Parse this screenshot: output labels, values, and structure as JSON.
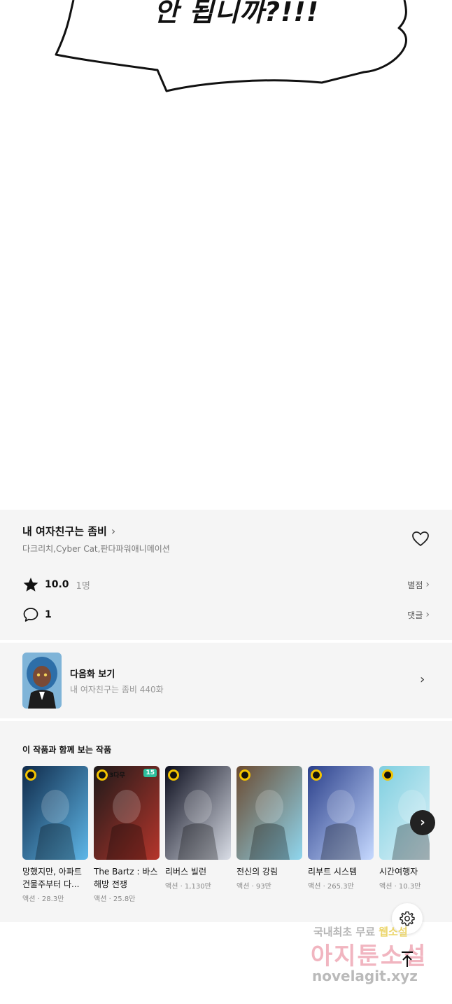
{
  "comic": {
    "bubble_text": "안 됩니까?!!!"
  },
  "work": {
    "title": "내 여자친구는 좀비",
    "title_chevron": "›",
    "authors": "다크리치,Cyber Cat,판다파워애니메이션",
    "rating_value": "10.0",
    "rating_count": "1명",
    "rating_link": "별점",
    "comment_count": "1",
    "comment_link": "댓글",
    "link_chevron": "›"
  },
  "next_episode": {
    "label": "다음화 보기",
    "subtitle": "내 여자친구는 좀비 440화",
    "chevron": "›"
  },
  "recommendations": {
    "heading": "이 작품과 함께 보는 작품",
    "items": [
      {
        "title": "망했지만, 아파트 건물주부터 다...",
        "meta": "액션 · 28.3만",
        "badge": "",
        "num": "",
        "color_a": "#0f2a4a",
        "color_b": "#5fb7e8"
      },
      {
        "title": "The Bartz : 바스해방 전쟁",
        "meta": "액션 · 25.8만",
        "badge": "3다무",
        "num": "15",
        "color_a": "#1d1a1a",
        "color_b": "#b5352b"
      },
      {
        "title": "리버스 빌런",
        "meta": "액션 · 1,130만",
        "badge": "",
        "num": "",
        "color_a": "#0b0d1d",
        "color_b": "#d9dde6"
      },
      {
        "title": "전신의 강림",
        "meta": "액션 · 93만",
        "badge": "",
        "num": "",
        "color_a": "#6b4a30",
        "color_b": "#8fd6ee"
      },
      {
        "title": "리부트 시스템",
        "meta": "액션 · 265.3만",
        "badge": "",
        "num": "",
        "color_a": "#2a3f8a",
        "color_b": "#c6d9ff"
      },
      {
        "title": "시간여행자",
        "meta": "액션 · 10.3만",
        "badge": "",
        "num": "",
        "color_a": "#7fcfe0",
        "color_b": "#e9f6fb"
      }
    ],
    "next_arrow": "›"
  },
  "watermark": {
    "line1_a": "국내최초 무료 ",
    "line1_b": "웹소설",
    "line2": "아지툰소설",
    "line3": "novelagit.xyz"
  },
  "colors": {
    "section_bg": "#f5f5f5",
    "badge_green": "#2dbf9d",
    "clock_yellow": "#f2c300"
  },
  "icons": {
    "heart": "heart-icon",
    "star": "star-icon",
    "comment": "comment-icon",
    "settings": "gear-icon",
    "scroll_top": "arrow-up-icon"
  }
}
